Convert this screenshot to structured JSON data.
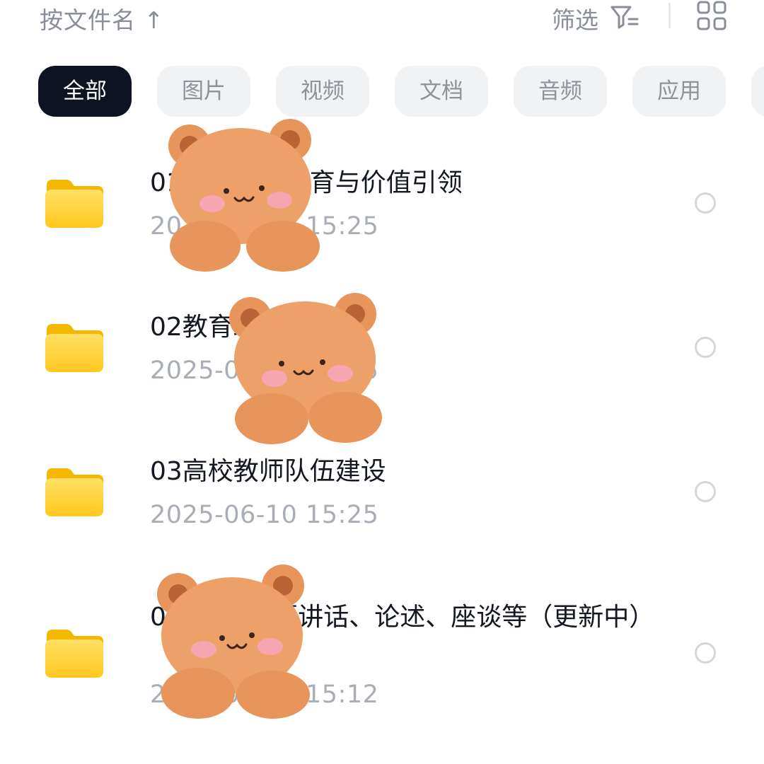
{
  "toolbar": {
    "sort_label": "按文件名 ↑",
    "filter_label": "筛选",
    "filter_icon": "filter-icon",
    "view_icon": "grid-view-icon"
  },
  "categories": [
    {
      "label": "全部",
      "active": true
    },
    {
      "label": "图片",
      "active": false
    },
    {
      "label": "视频",
      "active": false
    },
    {
      "label": "文档",
      "active": false
    },
    {
      "label": "音频",
      "active": false
    },
    {
      "label": "应用",
      "active": false
    }
  ],
  "files": [
    {
      "title": "01思想政治教育与价值引领",
      "date": "2025-06-10  15:25",
      "icon": "folder-icon"
    },
    {
      "title": "02教育政策法规",
      "date": "2025-06-10  15:25",
      "icon": "folder-icon"
    },
    {
      "title": "03高校教师队伍建设",
      "date": "2025-06-10  15:25",
      "icon": "folder-icon"
    },
    {
      "title": "04D大D重要讲话、论述、座谈等（更新中）",
      "date": "2025-06-10  15:12",
      "icon": "folder-icon"
    }
  ],
  "colors": {
    "active_chip": "#0d1320",
    "chip_bg": "#f1f2f4",
    "folder_yellow": "#ffd23c",
    "muted_text": "#a9adb6"
  }
}
